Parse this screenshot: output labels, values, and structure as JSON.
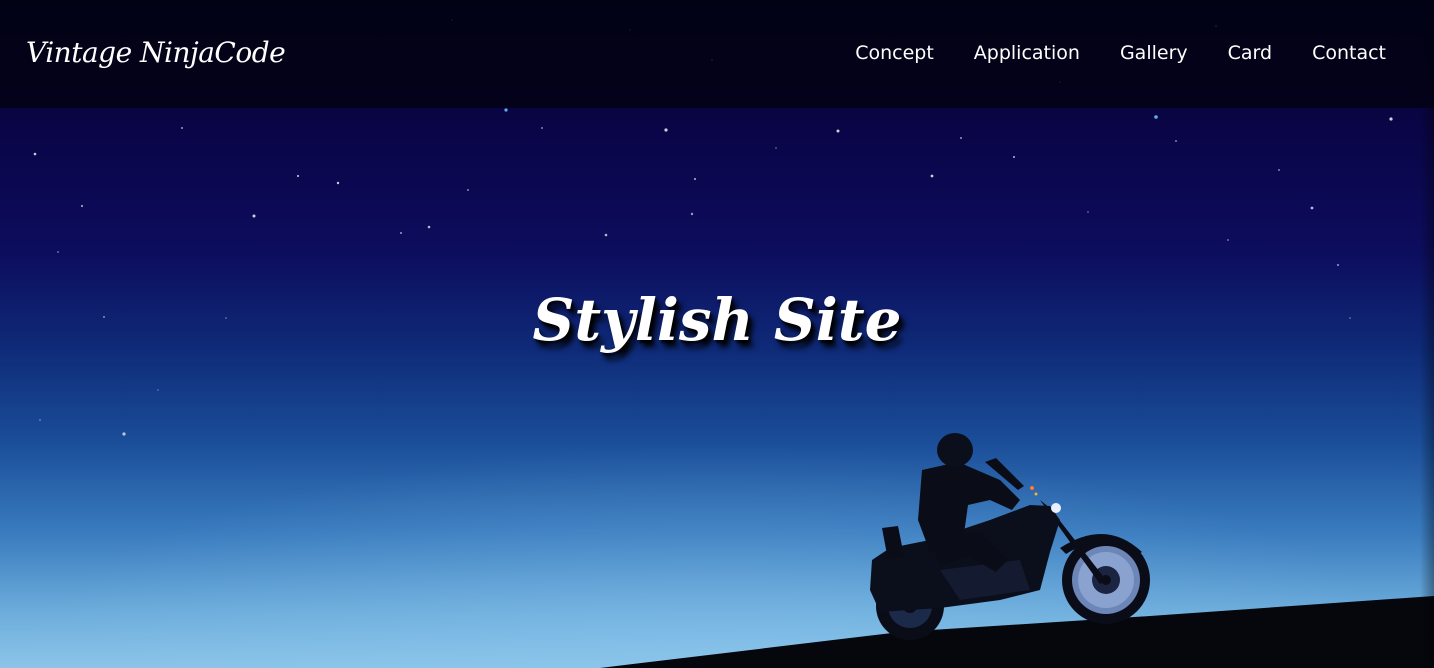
{
  "header": {
    "logo": "Vintage NinjaCode",
    "nav": [
      {
        "label": "Concept"
      },
      {
        "label": "Application"
      },
      {
        "label": "Gallery"
      },
      {
        "label": "Card"
      },
      {
        "label": "Contact"
      }
    ]
  },
  "hero": {
    "title": "Stylish Site",
    "background_image": "night sky with motorcycle rider silhouette",
    "colors": {
      "sky_top": "#040325",
      "sky_mid": "#0e2a78",
      "sky_bottom": "#8cc4e8",
      "header_bg": "#030212"
    }
  }
}
